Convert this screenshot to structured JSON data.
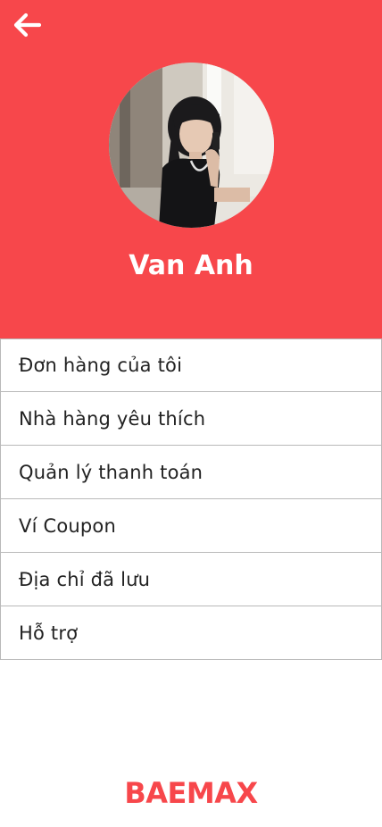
{
  "header": {
    "back_icon": "arrow-left-icon",
    "background_color": "#f7474b",
    "avatar_alt": "profile-photo",
    "user_name": "Van Anh"
  },
  "menu": {
    "items": [
      {
        "label": "Đơn hàng của tôi"
      },
      {
        "label": "Nhà hàng yêu thích"
      },
      {
        "label": "Quản lý thanh toán"
      },
      {
        "label": "Ví Coupon"
      },
      {
        "label": "Địa chỉ đã lưu"
      },
      {
        "label": "Hỗ trợ"
      }
    ]
  },
  "footer": {
    "brand": "BAEMAX",
    "brand_color": "#f7474b"
  }
}
